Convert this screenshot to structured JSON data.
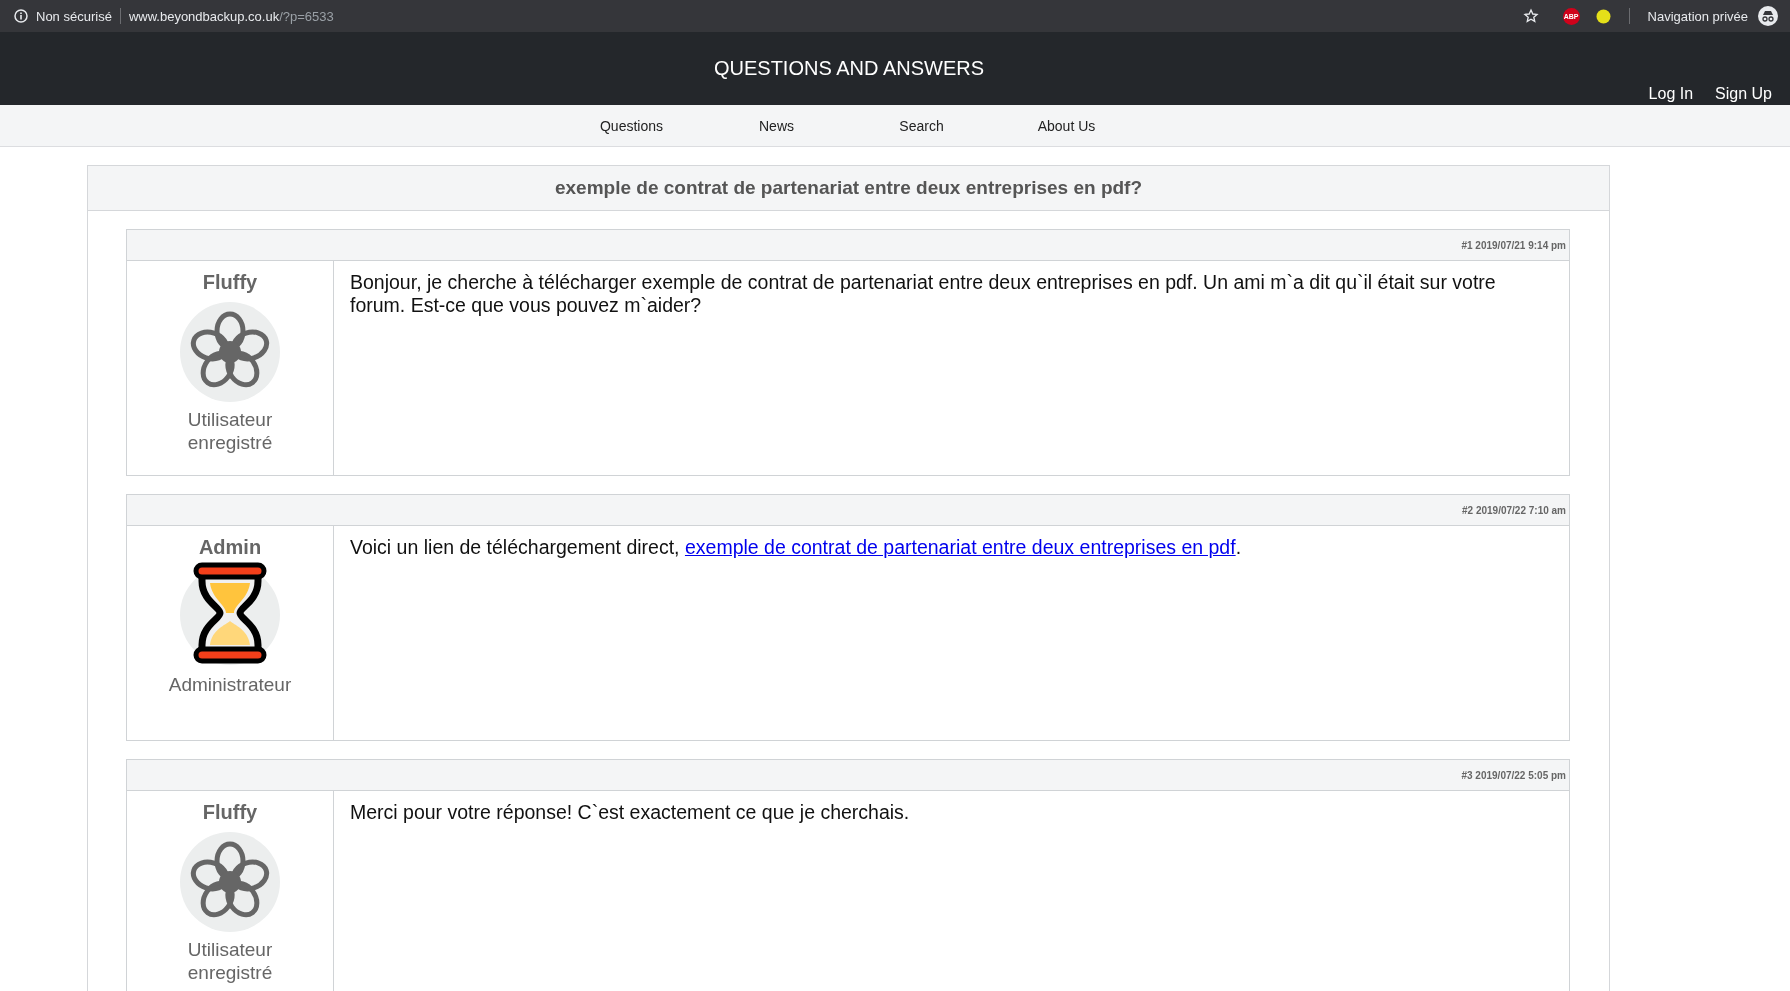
{
  "browser": {
    "security": "Non sécurisé",
    "url_host": "www.beyondbackup.co.uk",
    "url_path": "/?p=6533",
    "profile": "Navigation privée",
    "extension": "ABP"
  },
  "header": {
    "title": "QUESTIONS AND ANSWERS",
    "auth": [
      "Log In",
      "Sign Up"
    ]
  },
  "nav": [
    "Questions",
    "News",
    "Search",
    "About Us"
  ],
  "question": {
    "title": "exemple de contrat de partenariat entre deux entreprises en pdf?"
  },
  "posts": [
    {
      "meta": "#1 2019/07/21 9:14 pm",
      "author": "Fluffy",
      "kind": "flower",
      "role": "Utilisateur enregistré",
      "text": "Bonjour, je cherche à télécharger exemple de contrat de partenariat entre deux entreprises en pdf. Un ami m`a dit qu`il était sur votre forum. Est-ce que vous pouvez m`aider?"
    },
    {
      "meta": "#2 2019/07/22 7:10 am",
      "author": "Admin",
      "kind": "hourglass",
      "role": "Administrateur",
      "text": "Voici un lien de téléchargement direct, ",
      "link": "exemple de contrat de partenariat entre deux entreprises en pdf",
      "text_after": "."
    },
    {
      "meta": "#3 2019/07/22 5:05 pm",
      "author": "Fluffy",
      "kind": "flower",
      "role": "Utilisateur enregistré",
      "text": "Merci pour votre réponse! C`est exactement ce que je cherchais."
    }
  ]
}
